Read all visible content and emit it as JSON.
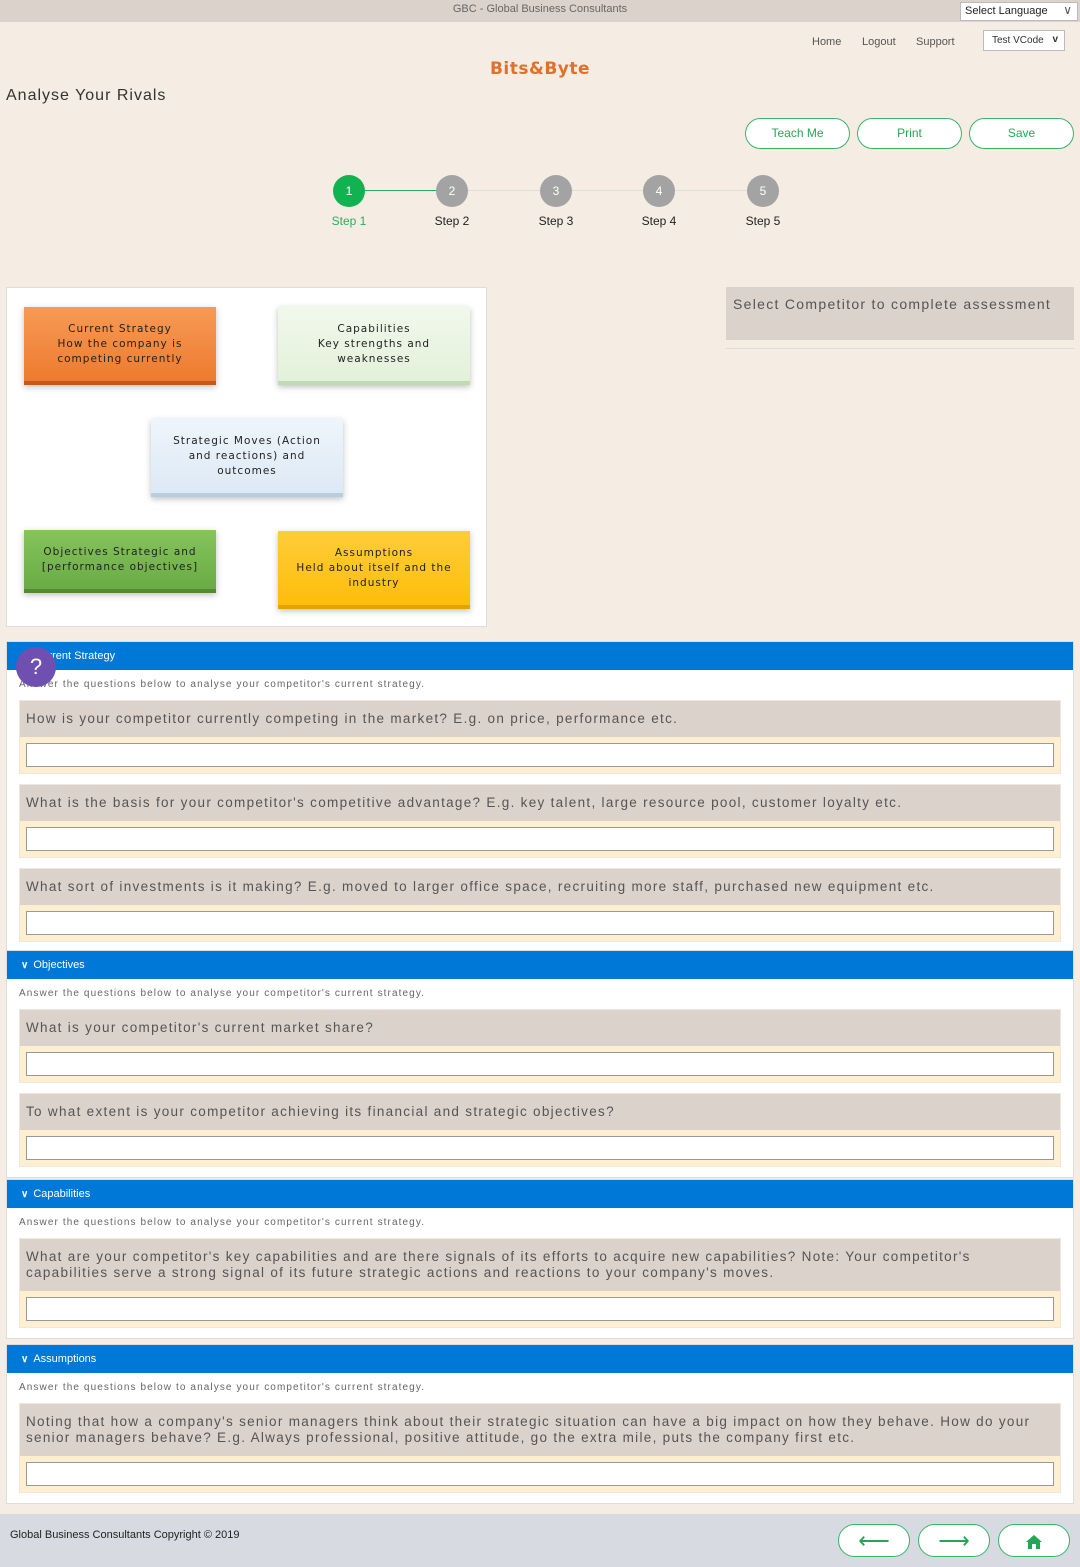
{
  "topbar": {
    "site_title": "GBC - Global Business Consultants",
    "language_select": "Select Language"
  },
  "nav": {
    "home": "Home",
    "logout": "Logout",
    "support": "Support",
    "vcode_select": "Test VCode"
  },
  "brand": "Bits&Byte",
  "page_title": "Analyse Your Rivals",
  "actions": {
    "teach_me": "Teach Me",
    "print": "Print",
    "save": "Save"
  },
  "stepper": {
    "current": 1,
    "steps": [
      {
        "number": "1",
        "label": "Step 1"
      },
      {
        "number": "2",
        "label": "Step 2"
      },
      {
        "number": "3",
        "label": "Step 3"
      },
      {
        "number": "4",
        "label": "Step 4"
      },
      {
        "number": "5",
        "label": "Step 5"
      }
    ]
  },
  "diagram": {
    "current_strategy": {
      "title": "Current Strategy",
      "text": "How the company is competing currently"
    },
    "capabilities": {
      "title": "Capabilities",
      "text": "Key strengths and weaknesses"
    },
    "strategic_moves": {
      "title": "",
      "text": "Strategic Moves (Action and reactions) and outcomes"
    },
    "objectives": {
      "title": "",
      "text": "Objectives Strategic and [performance objectives]"
    },
    "assumptions": {
      "title": "Assumptions",
      "text": "Held about itself and the industry"
    }
  },
  "competitor_prompt": "Select Competitor to complete assessment",
  "help_icon": "?",
  "sections": [
    {
      "title": "Current Strategy",
      "intro": "Answer the questions below to analyse your competitor's current strategy.",
      "questions": [
        {
          "text": "How is your competitor currently competing in the market? E.g. on price, performance etc.",
          "answer": ""
        },
        {
          "text": "What is the basis for your competitor's competitive advantage? E.g. key talent, large resource pool, customer loyalty etc.",
          "answer": ""
        },
        {
          "text": "What sort of investments is it making? E.g. moved to larger office space, recruiting more staff, purchased new equipment etc.",
          "answer": ""
        }
      ]
    },
    {
      "title": "Objectives",
      "intro": "Answer the questions below to analyse your competitor's current strategy.",
      "questions": [
        {
          "text": "What is your competitor's current market share?",
          "answer": ""
        },
        {
          "text": "To what extent is your competitor achieving its financial and strategic objectives?",
          "answer": ""
        }
      ]
    },
    {
      "title": "Capabilities",
      "intro": "Answer the questions below to analyse your competitor's current strategy.",
      "questions": [
        {
          "text": "What are your competitor's key capabilities and are there signals of its efforts to acquire new capabilities? Note: Your competitor's capabilities serve a strong signal of its future strategic actions and reactions to your company's moves.",
          "answer": ""
        }
      ]
    },
    {
      "title": "Assumptions",
      "intro": "Answer the questions below to analyse your competitor's current strategy.",
      "questions": [
        {
          "text": "Noting that how a company's senior managers think about their strategic situation can have a big impact on how they behave. How do your senior managers behave? E.g. Always professional, positive attitude, go the extra mile, puts the company first etc.",
          "answer": ""
        }
      ]
    }
  ],
  "footer": {
    "copyright": "Global Business Consultants Copyright © 2019",
    "back_icon": "⟵",
    "next_icon": "⟶",
    "home_icon": "home"
  },
  "colors": {
    "brand": "#e0702a",
    "accent_green": "#11b351",
    "section_blue": "#0078d7",
    "help_purple": "#6f4fb0"
  }
}
